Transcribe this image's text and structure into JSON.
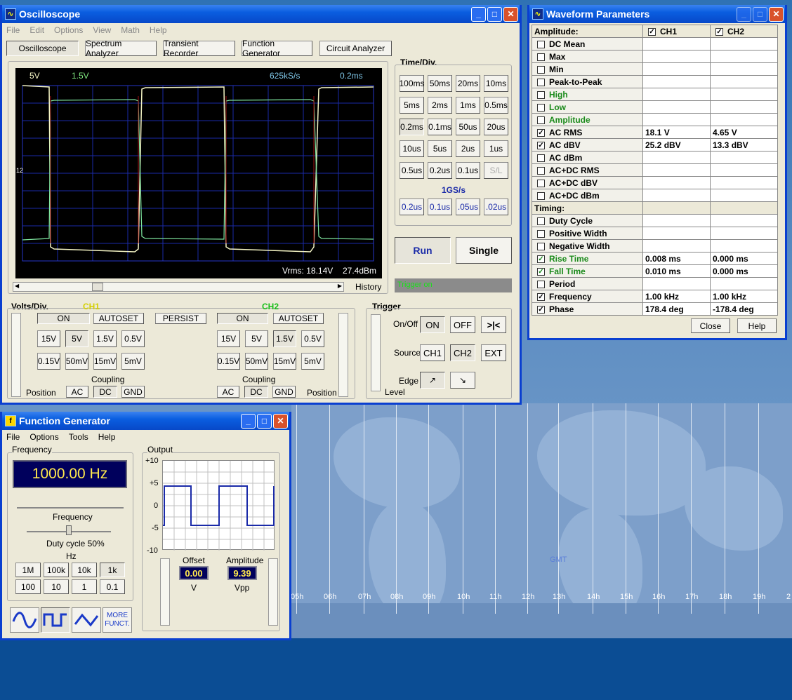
{
  "desktop": {
    "time_zones": [
      "05h",
      "06h",
      "07h",
      "08h",
      "09h",
      "10h",
      "11h",
      "12h",
      "13h",
      "14h",
      "15h",
      "16h",
      "17h",
      "18h",
      "19h",
      "2"
    ],
    "gmt_label": "GMT"
  },
  "oscilloscope": {
    "title": "Oscilloscope",
    "menu": [
      "File",
      "Edit",
      "Options",
      "View",
      "Math",
      "Help"
    ],
    "tabs": [
      "Oscilloscope",
      "Spectrum Analyzer",
      "Transient Recorder",
      "Function Generator",
      "Circuit Analyzer"
    ],
    "screen": {
      "ch1_scale": "5V",
      "ch2_scale": "1.5V",
      "sample_rate": "625kS/s",
      "timebase": "0.2ms",
      "vrms": "Vrms: 18.14V",
      "dbm": "27.4dBm",
      "marker": "12"
    },
    "timediv": {
      "label": "Time/Div.",
      "rows": [
        [
          "100ms",
          "50ms",
          "20ms",
          "10ms"
        ],
        [
          "5ms",
          "2ms",
          "1ms",
          "0.5ms"
        ],
        [
          "0.2ms",
          "0.1ms",
          "50us",
          "20us"
        ],
        [
          "10us",
          "5us",
          "2us",
          "1us"
        ],
        [
          "0.5us",
          "0.2us",
          "0.1us",
          "S/L"
        ]
      ],
      "gs_label": "1GS/s",
      "fast": [
        "0.2us",
        "0.1us",
        ".05us",
        ".02us"
      ]
    },
    "run_label": "Run",
    "single_label": "Single",
    "history_label": "History",
    "trigger_status": "Trigger on",
    "volts": {
      "label": "Volts/Div.",
      "ch1": "CH1",
      "ch2": "CH2",
      "on": "ON",
      "autoset": "AUTOSET",
      "persist": "PERSIST",
      "row1": [
        "15V",
        "5V",
        "1.5V",
        "0.5V"
      ],
      "row2": [
        "0.15V",
        "50mV",
        "15mV",
        "5mV"
      ],
      "coupling": "Coupling",
      "ac": "AC",
      "dc": "DC",
      "gnd": "GND",
      "position": "Position"
    },
    "trigger": {
      "label": "Trigger",
      "onoff": "On/Off",
      "on": "ON",
      "off": "OFF",
      "toggle": ">|<",
      "source": "Source",
      "ch1": "CH1",
      "ch2": "CH2",
      "ext": "EXT",
      "edge": "Edge",
      "level": "Level"
    }
  },
  "params": {
    "title": "Waveform Parameters",
    "amplitude_header": "Amplitude:",
    "ch1": "CH1",
    "ch2": "CH2",
    "timing_header": "Timing:",
    "amp_rows": [
      {
        "label": "DC  Mean",
        "checked": false,
        "green": false,
        "v1": "",
        "v2": ""
      },
      {
        "label": "Max",
        "checked": false,
        "green": false,
        "v1": "",
        "v2": ""
      },
      {
        "label": "Min",
        "checked": false,
        "green": false,
        "v1": "",
        "v2": ""
      },
      {
        "label": "Peak-to-Peak",
        "checked": false,
        "green": false,
        "v1": "",
        "v2": ""
      },
      {
        "label": "High",
        "checked": false,
        "green": true,
        "v1": "",
        "v2": ""
      },
      {
        "label": "Low",
        "checked": false,
        "green": true,
        "v1": "",
        "v2": ""
      },
      {
        "label": "Amplitude",
        "checked": false,
        "green": true,
        "v1": "",
        "v2": ""
      },
      {
        "label": "AC RMS",
        "checked": true,
        "green": false,
        "v1": "18.1 V",
        "v2": "4.65 V"
      },
      {
        "label": "AC dBV",
        "checked": true,
        "green": false,
        "v1": "25.2 dBV",
        "v2": "13.3 dBV"
      },
      {
        "label": "AC dBm",
        "checked": false,
        "green": false,
        "v1": "",
        "v2": ""
      },
      {
        "label": "AC+DC RMS",
        "checked": false,
        "green": false,
        "v1": "",
        "v2": ""
      },
      {
        "label": "AC+DC dBV",
        "checked": false,
        "green": false,
        "v1": "",
        "v2": ""
      },
      {
        "label": "AC+DC dBm",
        "checked": false,
        "green": false,
        "v1": "",
        "v2": ""
      }
    ],
    "timing_rows": [
      {
        "label": "Duty Cycle",
        "checked": false,
        "green": false,
        "v1": "",
        "v2": ""
      },
      {
        "label": "Positive Width",
        "checked": false,
        "green": false,
        "v1": "",
        "v2": ""
      },
      {
        "label": "Negative Width",
        "checked": false,
        "green": false,
        "v1": "",
        "v2": ""
      },
      {
        "label": "Rise Time",
        "checked": true,
        "green": true,
        "v1": "0.008 ms",
        "v2": "0.000 ms"
      },
      {
        "label": "Fall Time",
        "checked": true,
        "green": true,
        "v1": "0.010 ms",
        "v2": "0.000 ms"
      },
      {
        "label": "Period",
        "checked": false,
        "green": false,
        "v1": "",
        "v2": ""
      },
      {
        "label": "Frequency",
        "checked": true,
        "green": false,
        "v1": "1.00 kHz",
        "v2": "1.00 kHz"
      },
      {
        "label": "Phase",
        "checked": true,
        "green": false,
        "v1": "178.4 deg",
        "v2": "-178.4 deg"
      }
    ],
    "close_label": "Close",
    "help_label": "Help"
  },
  "funcgen": {
    "title": "Function Generator",
    "menu": [
      "File",
      "Options",
      "Tools",
      "Help"
    ],
    "frequency_group": "Frequency",
    "display": "1000.00 Hz",
    "freq_label": "Frequency",
    "duty_label": "Duty cycle 50%",
    "hz_label": "Hz",
    "range_row1": [
      "1M",
      "100k",
      "10k",
      "1k"
    ],
    "range_row2": [
      "100",
      "10",
      "1",
      "0.1"
    ],
    "more_label": "MORE FUNCT.",
    "output_group": "Output",
    "y_ticks": [
      "+10",
      "+5",
      "0",
      "-5",
      "-10"
    ],
    "offset_label": "Offset",
    "offset_value": "0.00",
    "offset_unit": "V",
    "amplitude_label": "Amplitude",
    "amplitude_value": "9.39",
    "amplitude_unit": "Vpp"
  }
}
